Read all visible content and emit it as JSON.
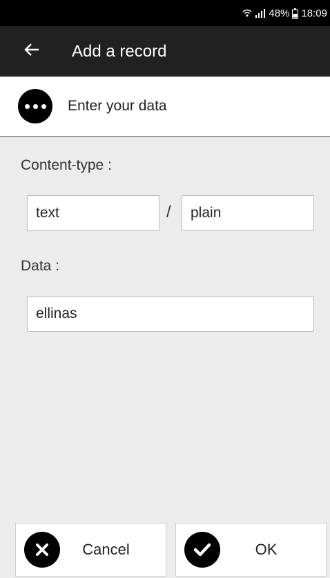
{
  "status_bar": {
    "battery": "48%",
    "time": "18:09"
  },
  "app_bar": {
    "title": "Add a record"
  },
  "header": {
    "text": "Enter your data"
  },
  "form": {
    "content_type_label": "Content-type :",
    "content_type_major": "text",
    "separator": "/",
    "content_type_minor": "plain",
    "data_label": "Data :",
    "data_value": "ellinas"
  },
  "buttons": {
    "cancel_label": "Cancel",
    "ok_label": "OK"
  },
  "icons": [
    "wifi-icon",
    "signal-icon",
    "battery-icon",
    "back-arrow-icon",
    "more-dots-icon",
    "cancel-x-icon",
    "ok-check-icon"
  ]
}
